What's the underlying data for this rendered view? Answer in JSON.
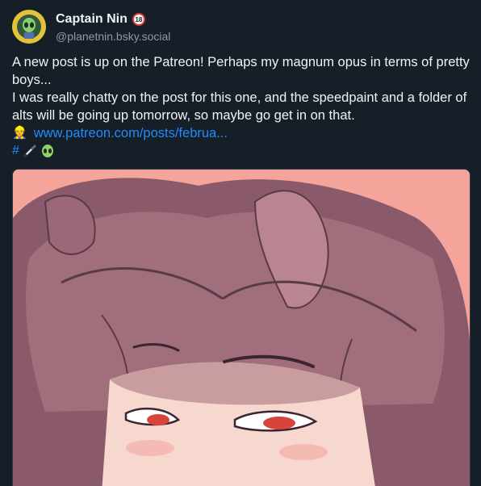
{
  "author": {
    "display_name": "Captain Nin",
    "age_badge": "18",
    "handle": "@planetnin.bsky.social",
    "avatar_icon": "alien-avatar-icon"
  },
  "post": {
    "line1": "A new post is up on the Patreon! Perhaps my magnum opus in terms of pretty boys...",
    "line2": "I was really chatty on the post for this one, and the speedpaint and a folder of alts will be going up tomorrow, so maybe go get in on that.",
    "link_emoji": "👷",
    "link_text": "www.patreon.com/posts/februa...",
    "hashtag": "#",
    "tag_icons": [
      "paintbrush-icon",
      "alien-icon"
    ]
  },
  "media": {
    "alt": "illustration",
    "icon": "illustration-image"
  },
  "colors": {
    "background": "#161e27",
    "link": "#208bfe",
    "text": "#f1f3f5",
    "muted": "#8c9aab",
    "media_bg": "#f4a49a"
  }
}
